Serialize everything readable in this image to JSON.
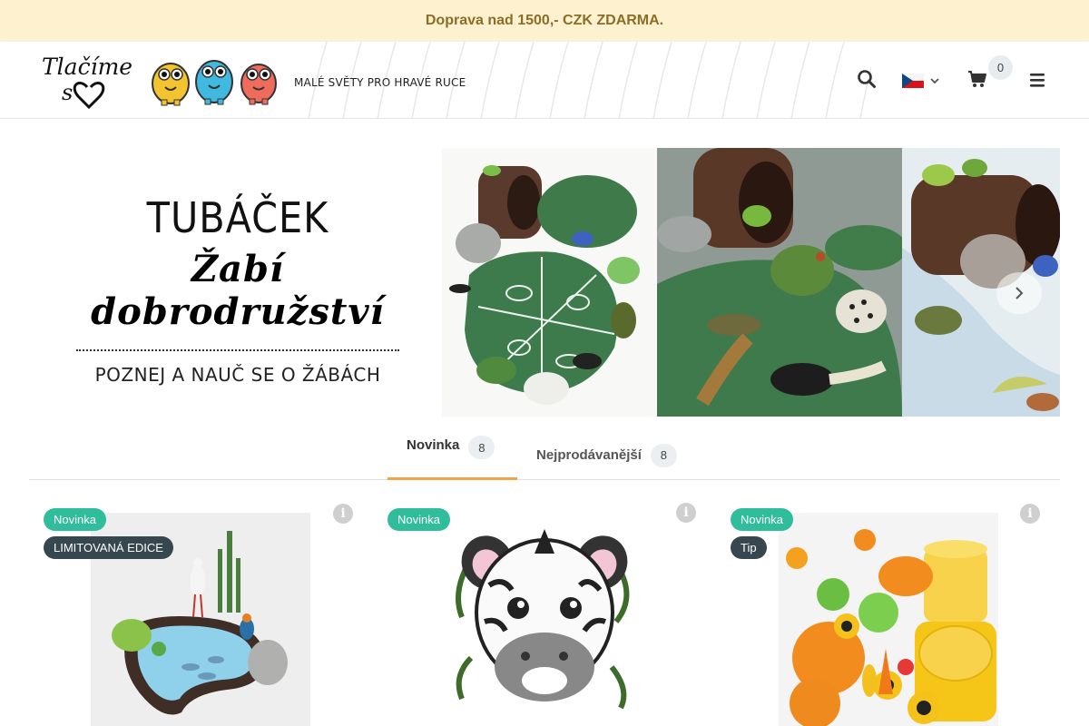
{
  "topbar": {
    "text": "Doprava nad 1500,- CZK ZDARMA."
  },
  "header": {
    "logo_text_line1": "Tlačíme",
    "logo_text_line2": "s",
    "tagline": "MALÉ SVĚTY PRO HRAVÉ RUCE",
    "cart_count": "0",
    "icons": [
      "search-icon",
      "flag-cz-icon",
      "chevron-down-icon",
      "cart-icon",
      "menu-icon"
    ]
  },
  "hero": {
    "title": "TUBÁČEK",
    "subtitle_script": "Žabí dobrodružství",
    "tagline": "POZNEJ A NAUČ SE O ŽÁBÁCH"
  },
  "tabs": [
    {
      "label": "Novinka",
      "count": "8",
      "active": true
    },
    {
      "label": "Nejprodávanější",
      "count": "8",
      "active": false
    }
  ],
  "products": [
    {
      "badges": [
        "Novinka",
        "LIMITOVANÁ EDICE"
      ]
    },
    {
      "badges": [
        "Novinka"
      ]
    },
    {
      "badges": [
        "Novinka",
        "Tip"
      ]
    }
  ],
  "colors": {
    "topbar_bg": "#fdf1d0",
    "topbar_text": "#8a6e25",
    "accent_orange": "#f3a34c",
    "badge_green": "#2fbd9c",
    "badge_dark": "#37474f"
  }
}
